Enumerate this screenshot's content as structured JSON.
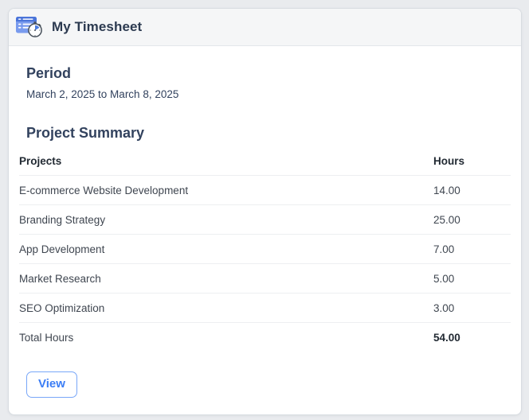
{
  "header": {
    "title": "My Timesheet",
    "icon": "timesheet-stopwatch-icon"
  },
  "period": {
    "heading": "Period",
    "date_range": "March 2, 2025 to March 8, 2025"
  },
  "project_summary": {
    "heading": "Project Summary",
    "columns": {
      "projects": "Projects",
      "hours": "Hours"
    },
    "rows": [
      {
        "project": "E-commerce Website Development",
        "hours": "14.00"
      },
      {
        "project": "Branding Strategy",
        "hours": "25.00"
      },
      {
        "project": "App Development",
        "hours": "7.00"
      },
      {
        "project": "Market Research",
        "hours": "5.00"
      },
      {
        "project": "SEO Optimization",
        "hours": "3.00"
      }
    ],
    "total": {
      "label": "Total Hours",
      "hours": "54.00"
    }
  },
  "actions": {
    "view": "View"
  },
  "colors": {
    "accent_blue": "#3b7df5",
    "heading_navy": "#32425e",
    "icon_table_blue": "#799bee",
    "icon_band_blue": "#4a74d9",
    "header_band_bg": "#f5f6f7",
    "page_bg": "#e9ebee"
  }
}
